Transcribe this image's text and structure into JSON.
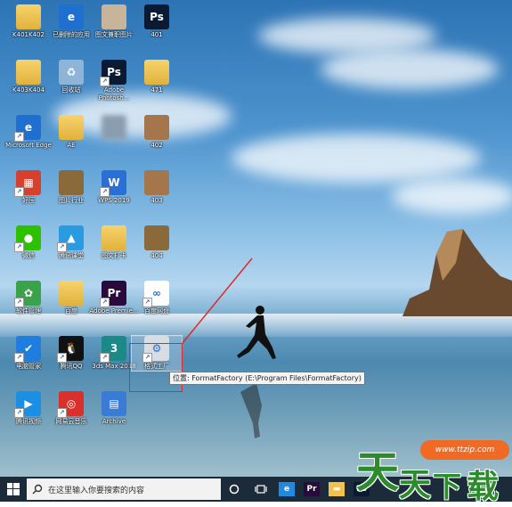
{
  "desktop": {
    "icons": [
      {
        "label": "K401K402",
        "glyph": "",
        "color": "",
        "kind": "folder",
        "shortcut": false
      },
      {
        "label": "已删除的应用",
        "glyph": "e",
        "color": "#1f6fd1",
        "kind": "app",
        "shortcut": false
      },
      {
        "label": "图文兼职图片",
        "glyph": "",
        "color": "#c7b49a",
        "kind": "photo",
        "shortcut": false
      },
      {
        "label": "401",
        "glyph": "Ps",
        "color": "#0b1a33",
        "kind": "app",
        "shortcut": false
      },
      {
        "label": "K403K404",
        "glyph": "",
        "color": "",
        "kind": "folder",
        "shortcut": false
      },
      {
        "label": "回收站",
        "glyph": "♻",
        "color": "#8fb5d6",
        "kind": "app",
        "shortcut": false
      },
      {
        "label": "Adobe Photosh...",
        "glyph": "Ps",
        "color": "#0b1a33",
        "kind": "app",
        "shortcut": true
      },
      {
        "label": "471",
        "glyph": "",
        "color": "",
        "kind": "folder",
        "shortcut": false
      },
      {
        "label": "Microsoft Edge",
        "glyph": "e",
        "color": "#1f6fd1",
        "kind": "app",
        "shortcut": true
      },
      {
        "label": "AE",
        "glyph": "",
        "color": "",
        "kind": "folder",
        "shortcut": false
      },
      {
        "label": "",
        "glyph": "",
        "color": "#8a9db0",
        "kind": "blur",
        "shortcut": false
      },
      {
        "label": "402",
        "glyph": "",
        "color": "#a5754b",
        "kind": "photo",
        "shortcut": false
      },
      {
        "label": "好压",
        "glyph": "▦",
        "color": "#d7402c",
        "kind": "app",
        "shortcut": true
      },
      {
        "label": "图片行业",
        "glyph": "",
        "color": "#8a6a3a",
        "kind": "photo",
        "shortcut": false
      },
      {
        "label": "WPS 2019",
        "glyph": "W",
        "color": "#2a6fd6",
        "kind": "app",
        "shortcut": true
      },
      {
        "label": "403",
        "glyph": "",
        "color": "#a5754b",
        "kind": "photo",
        "shortcut": false
      },
      {
        "label": "微信",
        "glyph": "●",
        "color": "#2dc100",
        "kind": "app",
        "shortcut": true
      },
      {
        "label": "腾讯课堂",
        "glyph": "▲",
        "color": "#2a9be0",
        "kind": "app",
        "shortcut": true
      },
      {
        "label": "图文打卡",
        "glyph": "",
        "color": "",
        "kind": "folder",
        "shortcut": false
      },
      {
        "label": "404",
        "glyph": "",
        "color": "#8a6a3a",
        "kind": "photo",
        "shortcut": false
      },
      {
        "label": "软件管理",
        "glyph": "✿",
        "color": "#3aa34a",
        "kind": "app",
        "shortcut": true
      },
      {
        "label": "百度",
        "glyph": "",
        "color": "",
        "kind": "folder",
        "shortcut": false
      },
      {
        "label": "Adobe Premie...",
        "glyph": "Pr",
        "color": "#2a0a3d",
        "kind": "app",
        "shortcut": true
      },
      {
        "label": "百度网盘",
        "glyph": "∞",
        "color": "#ffffff",
        "kind": "app",
        "shortcut": true
      },
      {
        "label": "电脑管家",
        "glyph": "✔",
        "color": "#1e7ee0",
        "kind": "app",
        "shortcut": true
      },
      {
        "label": "腾讯QQ",
        "glyph": "🐧",
        "color": "#111111",
        "kind": "app",
        "shortcut": true
      },
      {
        "label": "3ds Max 2018",
        "glyph": "3",
        "color": "#1b8a86",
        "kind": "app",
        "shortcut": true
      },
      {
        "label": "格式工厂",
        "glyph": "⚙",
        "color": "#d8dde3",
        "kind": "app",
        "shortcut": true
      },
      {
        "label": "腾讯视频",
        "glyph": "▶",
        "color": "#1a8fe3",
        "kind": "app",
        "shortcut": true
      },
      {
        "label": "网易云音乐",
        "glyph": "◎",
        "color": "#d9302b",
        "kind": "app",
        "shortcut": true
      },
      {
        "label": "Archive",
        "glyph": "▤",
        "color": "#3a7bd5",
        "kind": "app",
        "shortcut": false
      }
    ],
    "tooltip": "位置: FormatFactory (E:\\Program Files\\FormatFactory)",
    "highlight_color": "#e0282e"
  },
  "taskbar": {
    "search_placeholder": "在这里输入你要搜索的内容",
    "pinned": [
      {
        "name": "edge",
        "glyph": "e",
        "color": "#1f8be0"
      },
      {
        "name": "premiere",
        "glyph": "Pr",
        "color": "#2a0a3d"
      },
      {
        "name": "file-explorer",
        "glyph": "▬",
        "color": "#f2c14e"
      },
      {
        "name": "photoshop",
        "glyph": "Ps",
        "color": "#0b1a33"
      }
    ]
  },
  "watermark": {
    "chars": [
      "天",
      "天",
      "下",
      "载"
    ],
    "url": "www.ttzip.com"
  }
}
